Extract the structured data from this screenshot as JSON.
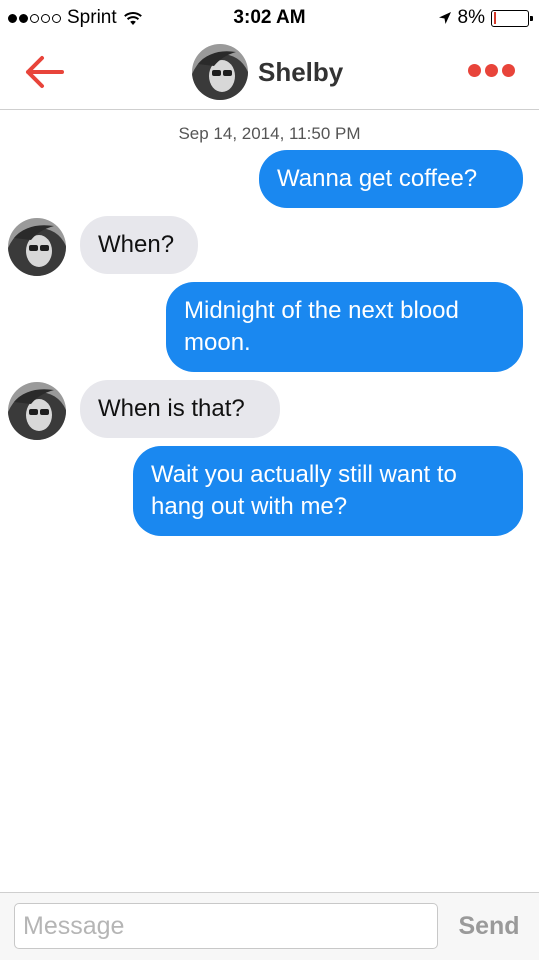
{
  "status_bar": {
    "carrier": "Sprint",
    "time": "3:02 AM",
    "battery_percent": "8%",
    "battery_level": 0.08,
    "signal_bars_filled": 2,
    "signal_bars_total": 5
  },
  "nav": {
    "contact_name": "Shelby",
    "back_icon": "back-arrow-icon",
    "more_icon": "more-dots-icon",
    "accent_color": "#e8443a"
  },
  "conversation": {
    "timestamp": "Sep 14, 2014, 11:50 PM",
    "messages": [
      {
        "direction": "outgoing",
        "text": "Wanna get coffee?"
      },
      {
        "direction": "incoming",
        "text": "When?"
      },
      {
        "direction": "outgoing",
        "text": "Midnight of the next blood moon."
      },
      {
        "direction": "incoming",
        "text": "When is that?"
      },
      {
        "direction": "outgoing",
        "text": "Wait you actually still want to hang out with me?"
      }
    ],
    "outgoing_color": "#1a88f0",
    "incoming_color": "#e7e7ec"
  },
  "composer": {
    "placeholder": "Message",
    "value": "",
    "send_label": "Send"
  }
}
